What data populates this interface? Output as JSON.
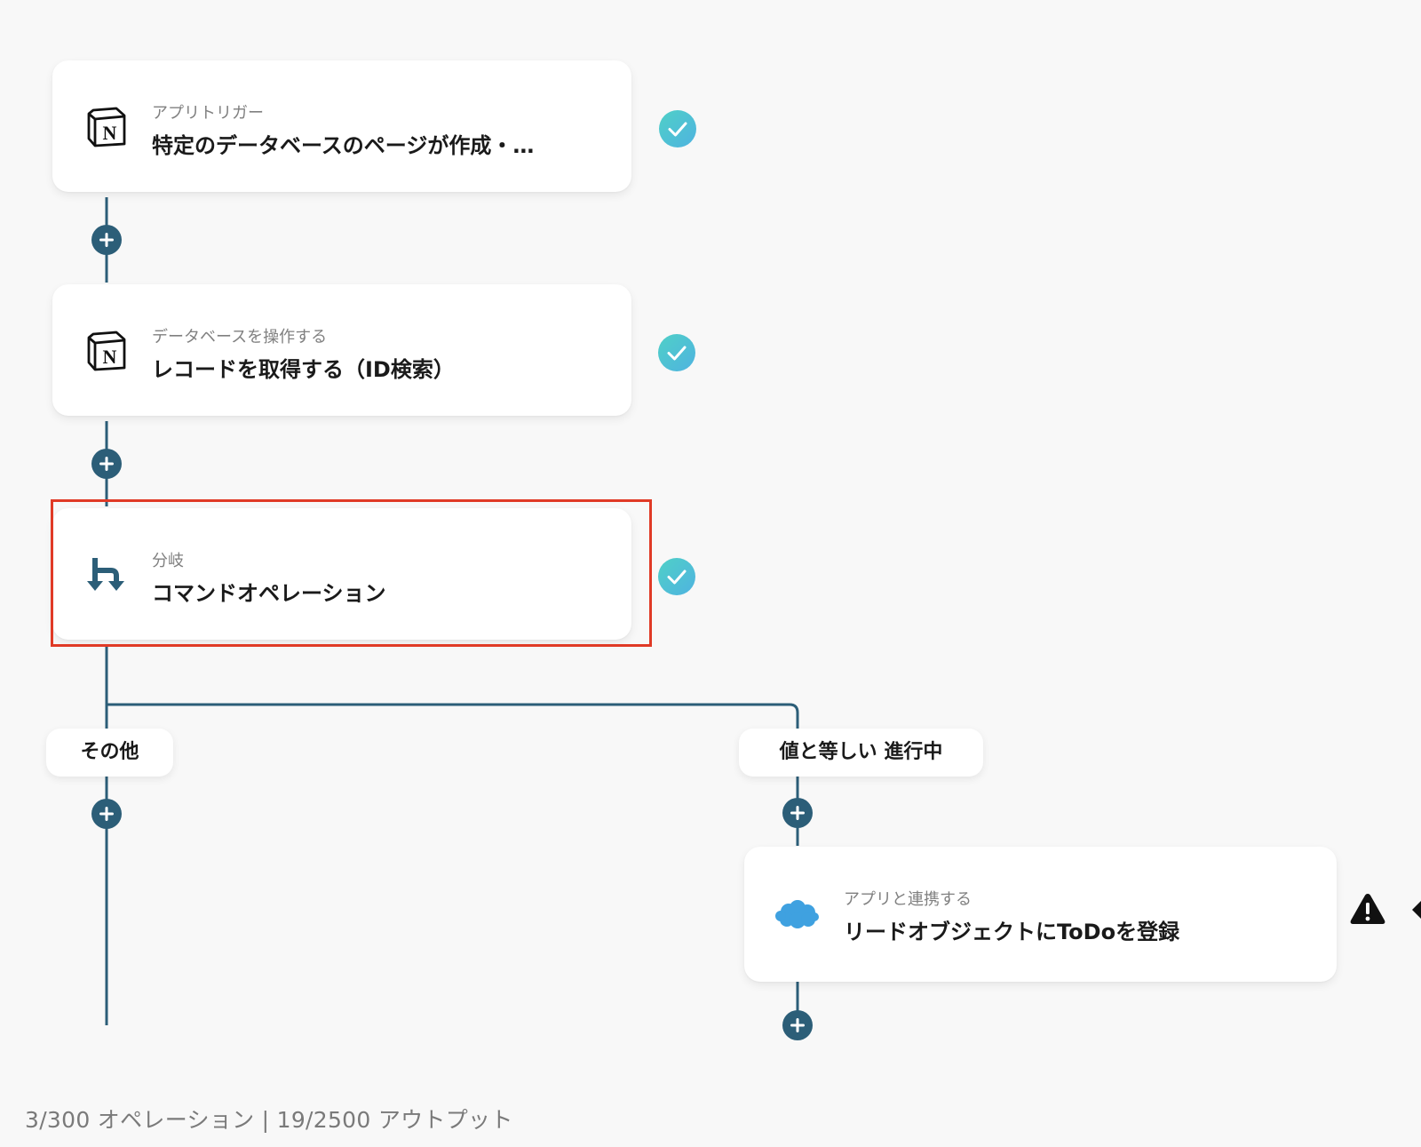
{
  "steps": [
    {
      "subtitle": "アプリトリガー",
      "title": "特定のデータベースのページが作成・…",
      "app_icon": "notion-icon",
      "status": "completed"
    },
    {
      "subtitle": "データベースを操作する",
      "title": "レコードを取得する（ID検索）",
      "app_icon": "notion-icon",
      "status": "completed"
    },
    {
      "subtitle": "分岐",
      "title": "コマンドオペレーション",
      "app_icon": "branch-icon",
      "status": "completed",
      "highlighted": true
    }
  ],
  "branches": {
    "other_label": "その他",
    "condition_label": "値と等しい 進行中"
  },
  "branch_step": {
    "subtitle": "アプリと連携する",
    "title": "リードオブジェクトにToDoを登録",
    "app_icon": "salesforce-icon",
    "status": "warning"
  },
  "footer": {
    "text": "3/300 オペレーション | 19/2500 アウトプット"
  },
  "colors": {
    "connector": "#2c5e78",
    "check": "#58c5d8",
    "highlight": "#e03a26",
    "salesforce": "#3fa1e0"
  }
}
